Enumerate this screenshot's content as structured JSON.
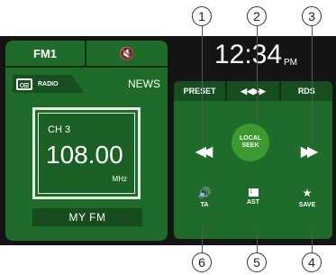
{
  "left_panel": {
    "band_tab": "FM1",
    "mute_icon": "🔇",
    "source_label": "RADIO",
    "genre": "NEWS",
    "channel": "CH 3",
    "frequency": "108.00",
    "unit": "MHz",
    "station_name": "MY FM"
  },
  "clock": {
    "time": "12:34",
    "ampm": "PM"
  },
  "right_panel": {
    "tabs": [
      "PRESET",
      "◀◀▶▶",
      "RDS"
    ],
    "seek_left": "◀◀",
    "seek_right": "▶▶",
    "local_seek_line1": "LOCAL",
    "local_seek_line2": "SEEK",
    "ta_icon": "🔊",
    "ta_label": "TA",
    "ast_label": "AST",
    "save_icon": "★",
    "save_label": "SAVE"
  },
  "callouts": [
    "1",
    "2",
    "3",
    "4",
    "5",
    "6"
  ],
  "colors": {
    "panel_green": "#1f6b2a",
    "seek_circle": "#3c9a31",
    "device_black": "#151515"
  }
}
